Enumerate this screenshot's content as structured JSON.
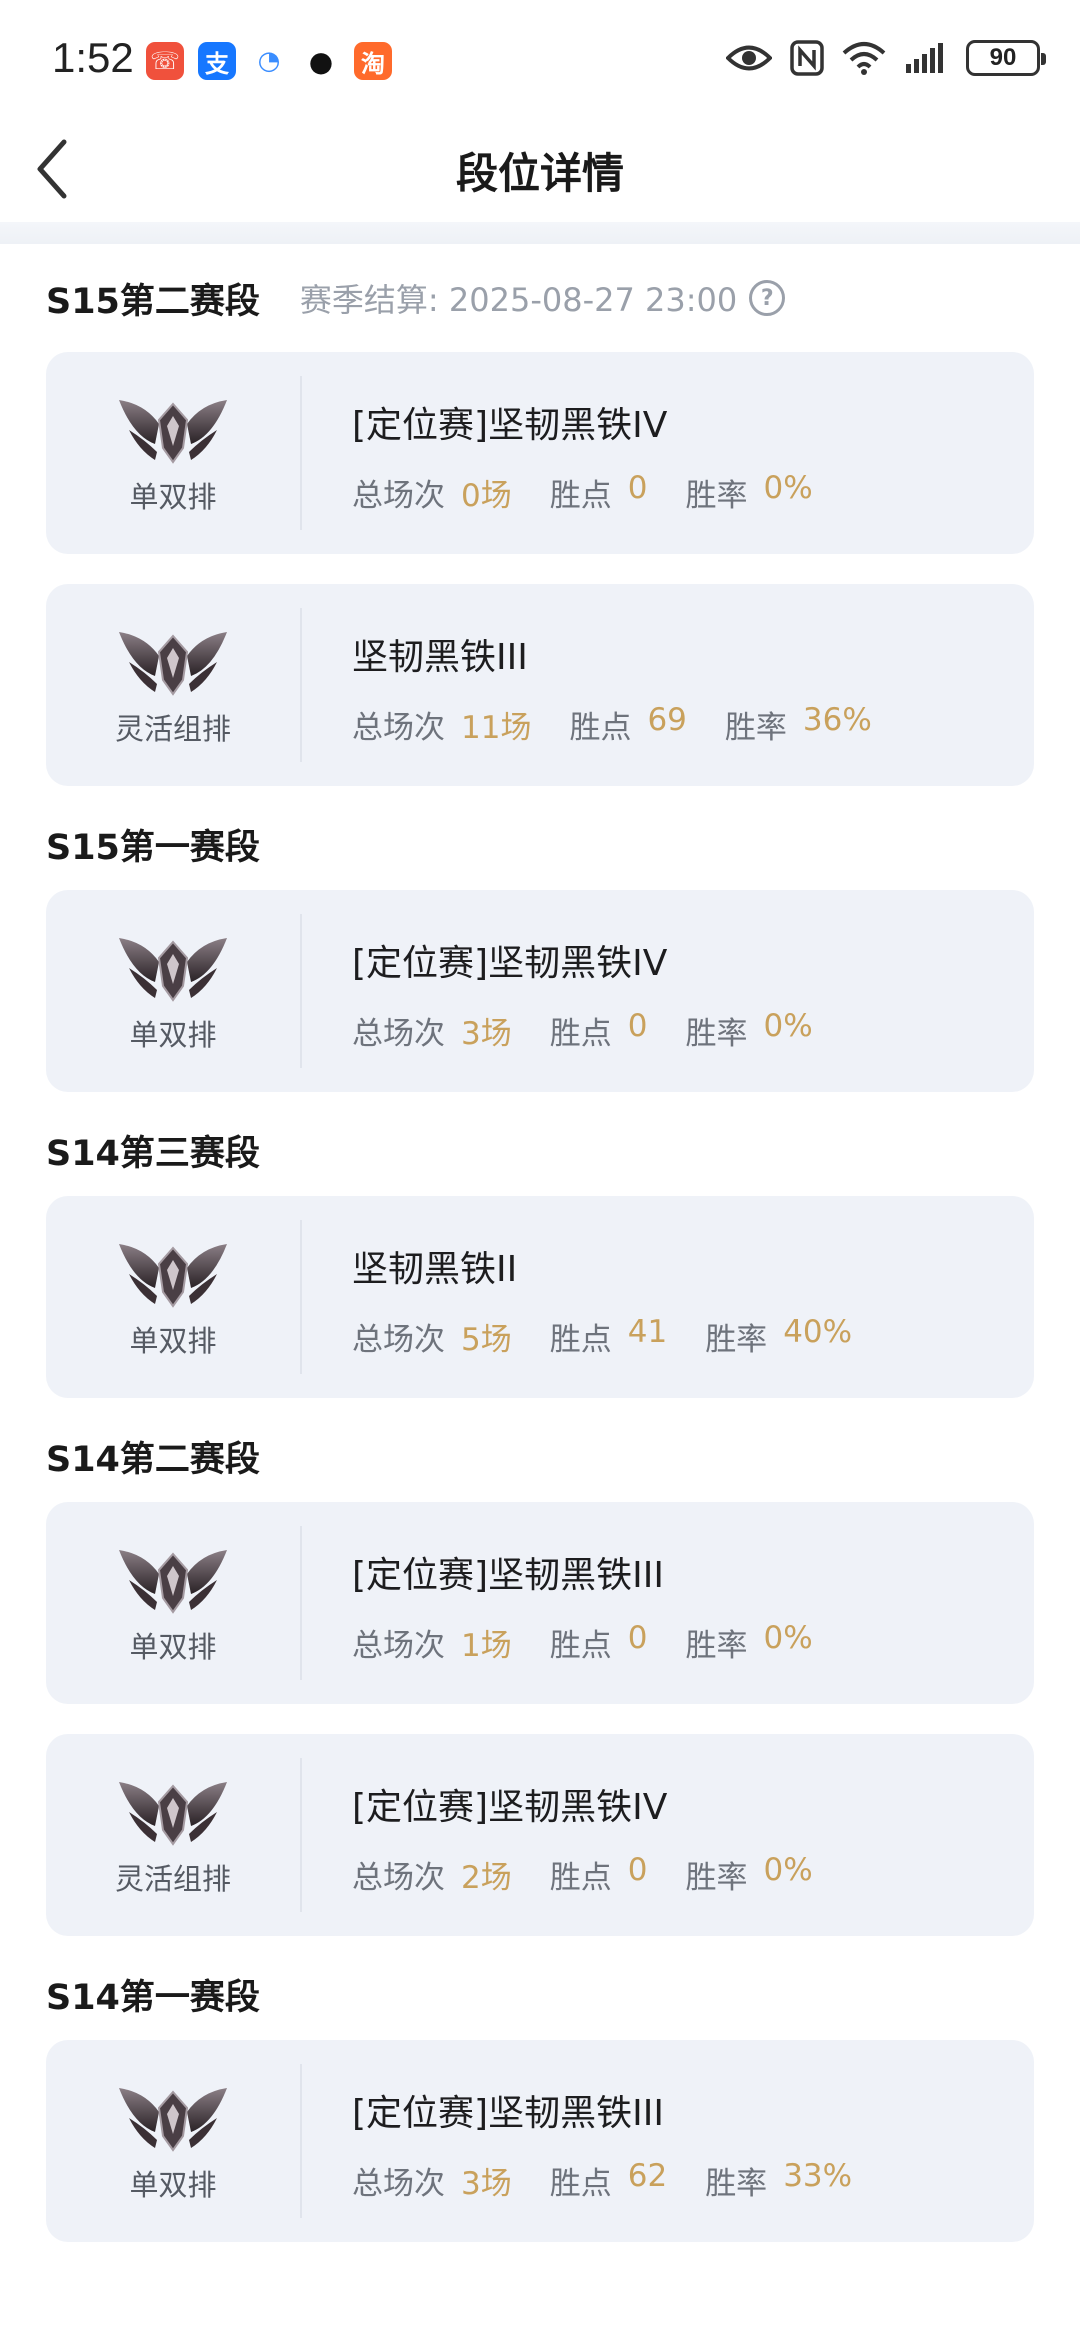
{
  "status_bar": {
    "time": "1:52",
    "battery": "90"
  },
  "header": {
    "title": "段位详情"
  },
  "sections": [
    {
      "title": "S15第二赛段",
      "settle_text": "赛季结算: 2025-08-27 23:00",
      "cards": [
        {
          "queue": "单双排",
          "rank": "[定位赛]坚韧黑铁IV",
          "games_label": "总场次",
          "games": "0场",
          "points_label": "胜点",
          "points": "0",
          "winrate_label": "胜率",
          "winrate": "0%"
        },
        {
          "queue": "灵活组排",
          "rank": "坚韧黑铁III",
          "games_label": "总场次",
          "games": "11场",
          "points_label": "胜点",
          "points": "69",
          "winrate_label": "胜率",
          "winrate": "36%"
        }
      ]
    },
    {
      "title": "S15第一赛段",
      "cards": [
        {
          "queue": "单双排",
          "rank": "[定位赛]坚韧黑铁IV",
          "games_label": "总场次",
          "games": "3场",
          "points_label": "胜点",
          "points": "0",
          "winrate_label": "胜率",
          "winrate": "0%"
        }
      ]
    },
    {
      "title": "S14第三赛段",
      "cards": [
        {
          "queue": "单双排",
          "rank": "坚韧黑铁II",
          "games_label": "总场次",
          "games": "5场",
          "points_label": "胜点",
          "points": "41",
          "winrate_label": "胜率",
          "winrate": "40%"
        }
      ]
    },
    {
      "title": "S14第二赛段",
      "cards": [
        {
          "queue": "单双排",
          "rank": "[定位赛]坚韧黑铁III",
          "games_label": "总场次",
          "games": "1场",
          "points_label": "胜点",
          "points": "0",
          "winrate_label": "胜率",
          "winrate": "0%"
        },
        {
          "queue": "灵活组排",
          "rank": "[定位赛]坚韧黑铁IV",
          "games_label": "总场次",
          "games": "2场",
          "points_label": "胜点",
          "points": "0",
          "winrate_label": "胜率",
          "winrate": "0%"
        }
      ]
    },
    {
      "title": "S14第一赛段",
      "cards": [
        {
          "queue": "单双排",
          "rank": "[定位赛]坚韧黑铁III",
          "games_label": "总场次",
          "games": "3场",
          "points_label": "胜点",
          "points": "62",
          "winrate_label": "胜率",
          "winrate": "33%"
        }
      ]
    }
  ],
  "colors": {
    "accent_value": "#c9a15c",
    "card_bg": "#eff2f8"
  },
  "icons": {
    "rank_emblem": "iron-rank-emblem-icon",
    "back": "back-arrow-icon",
    "help": "help-circle-icon"
  }
}
